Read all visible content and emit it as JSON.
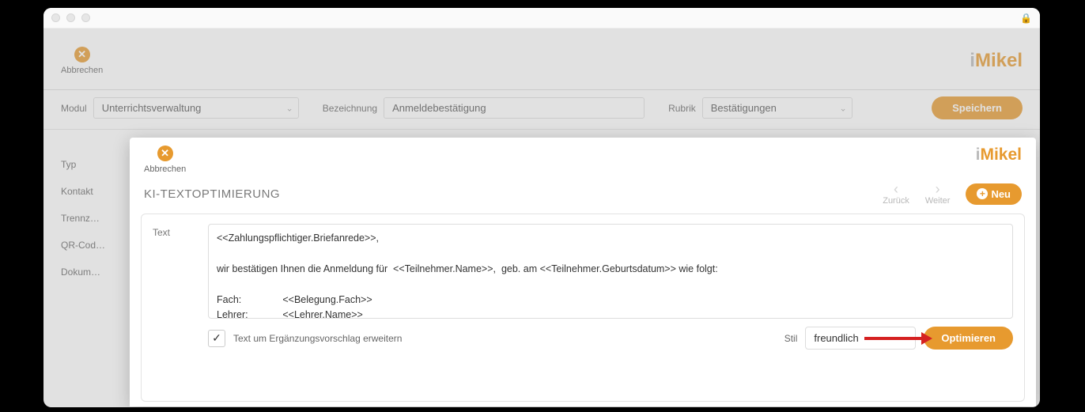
{
  "window": {
    "cancel_label": "Abbrechen",
    "brand_i": "i",
    "brand_rest": "Mikel"
  },
  "filters": {
    "modul_label": "Modul",
    "modul_value": "Unterrichtsverwaltung",
    "bezeichnung_label": "Bezeichnung",
    "bezeichnung_value": "Anmeldebestätigung",
    "rubrik_label": "Rubrik",
    "rubrik_value": "Bestätigungen",
    "save_label": "Speichern"
  },
  "side_labels": {
    "typ": "Typ",
    "kontakt": "Kontakt",
    "trenn": "Trennz…",
    "qr": "QR-Cod…",
    "dokum": "Dokum…"
  },
  "modal": {
    "cancel_label": "Abbrechen",
    "title": "KI-TEXTOPTIMIERUNG",
    "nav_back": "Zurück",
    "nav_next": "Weiter",
    "neu_label": "Neu",
    "text_label": "Text",
    "text_value": "<<Zahlungspflichtiger.Briefanrede>>,\n\nwir bestätigen Ihnen die Anmeldung für  <<Teilnehmer.Name>>,  geb. am <<Teilnehmer.Geburtsdatum>> wie folgt:\n\nFach:\t\t<<Belegung.Fach>>\nLehrer:\t\t<<Lehrer.Name>>\nUnterrichtsort:\t<<Veranstaltungsort.Firma>>, <<Veranstaltungsraum.Bezeichnung>>\nUnterrichtsbeginn:\t<<Belegung.ErsterTermin>>\nTermin:\t\t<<Belegung.Tag>>",
    "expand_label": "Text um Ergänzungsvorschlag erweitern",
    "stil_label": "Stil",
    "stil_value": "freundlich",
    "optimize_label": "Optimieren"
  }
}
